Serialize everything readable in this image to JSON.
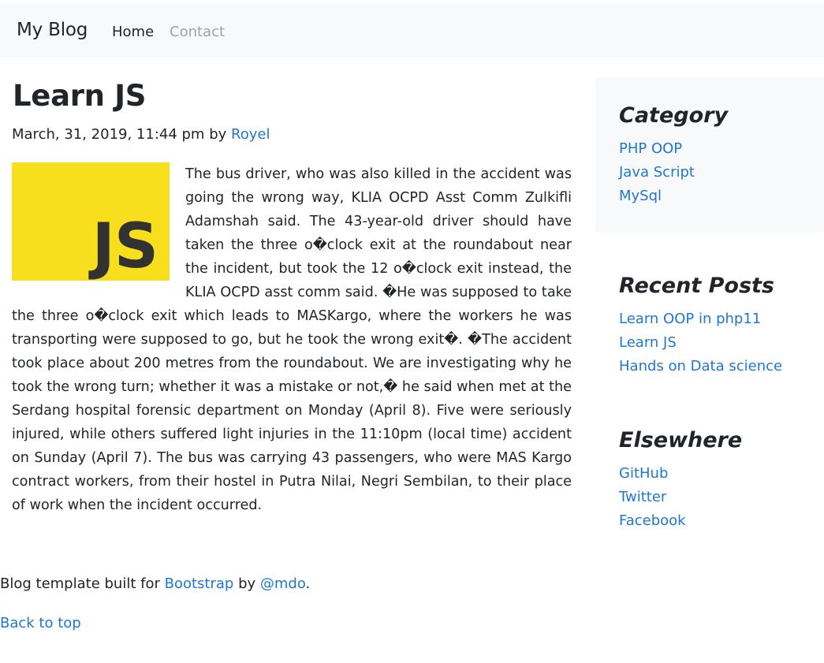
{
  "navbar": {
    "brand": "My Blog",
    "items": [
      {
        "label": "Home"
      },
      {
        "label": "Contact"
      }
    ]
  },
  "post": {
    "title": "Learn JS",
    "date": "March, 31, 2019, 11:44 pm",
    "by": "by",
    "author": "Royel",
    "image_text": "JS",
    "image_color": "#f7df1e",
    "body": "The bus driver, who was also killed in the accident was going the wrong way, KLIA OCPD Asst Comm Zulkifli Adamshah said. The 43-year-old driver should have taken the three o�clock exit at the roundabout near the incident, but took the 12 o�clock exit instead, the KLIA OCPD asst comm said. �He was supposed to take the three o�clock exit which leads to MASKargo, where the workers he was transporting were supposed to go, but he took the wrong exit�. �The accident took place about 200 metres from the roundabout. We are investigating why he took the wrong turn; whether it was a mistake or not,� he said when met at the Serdang hospital forensic department on Monday (April 8). Five were seriously injured, while others suffered light injuries in the 11:10pm (local time) accident on Sunday (April 7). The bus was carrying 43 passengers, who were MAS Kargo contract workers, from their hostel in Putra Nilai, Negri Sembilan, to their place of work when the incident occurred."
  },
  "sidebar": {
    "category": {
      "heading": "Category",
      "links": [
        "PHP OOP",
        "Java Script",
        "MySql"
      ]
    },
    "recent": {
      "heading": "Recent Posts",
      "links": [
        "Learn OOP in php11",
        "Learn JS",
        "Hands on Data science"
      ]
    },
    "elsewhere": {
      "heading": "Elsewhere",
      "links": [
        "GitHub",
        "Twitter",
        "Facebook"
      ]
    }
  },
  "footer": {
    "prefix": "Blog template built for",
    "bootstrap": "Bootstrap",
    "by": "by",
    "author": "@mdo",
    "suffix": ".",
    "back_to_top": "Back to top"
  },
  "colors": {
    "link": "#1f77cf",
    "navbar_bg": "#f8f9fa",
    "muted_nav": "#9ea3a8"
  }
}
